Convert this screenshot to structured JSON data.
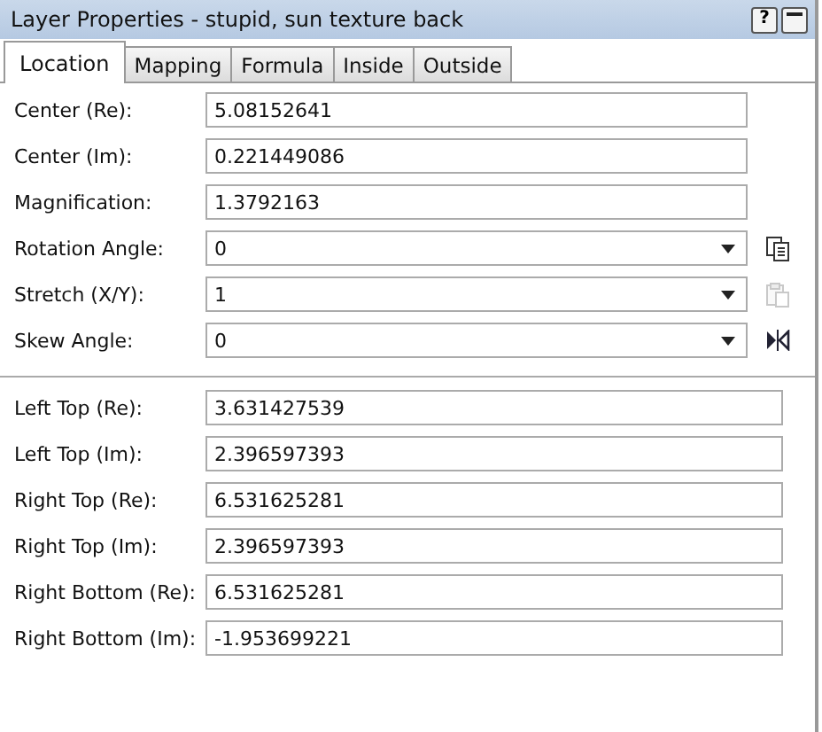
{
  "window": {
    "title": "Layer Properties - stupid, sun texture back",
    "help_label": "?"
  },
  "tabs": [
    {
      "label": "Location",
      "selected": true
    },
    {
      "label": "Mapping",
      "selected": false
    },
    {
      "label": "Formula",
      "selected": false
    },
    {
      "label": "Inside",
      "selected": false
    },
    {
      "label": "Outside",
      "selected": false
    }
  ],
  "view": [
    {
      "label": "Center (Re):",
      "value": "5.08152641",
      "kind": "text"
    },
    {
      "label": "Center (Im):",
      "value": "0.221449086",
      "kind": "text"
    },
    {
      "label": "Magnification:",
      "value": "1.3792163",
      "kind": "text"
    },
    {
      "label": "Rotation Angle:",
      "value": "0",
      "kind": "combo",
      "button_disabled": false
    },
    {
      "label": "Stretch (X/Y):",
      "value": "1",
      "kind": "combo",
      "button_disabled": true
    },
    {
      "label": "Skew Angle:",
      "value": "0",
      "kind": "combo",
      "button_disabled": false
    }
  ],
  "corners": [
    {
      "label": "Left Top (Re):",
      "value": "3.631427539"
    },
    {
      "label": "Left Top (Im):",
      "value": "2.396597393"
    },
    {
      "label": "Right Top (Re):",
      "value": "6.531625281"
    },
    {
      "label": "Right Top (Im):",
      "value": "2.396597393"
    },
    {
      "label": "Right Bottom (Re):",
      "value": "6.531625281"
    },
    {
      "label": "Right Bottom (Im):",
      "value": "-1.953699221"
    }
  ]
}
